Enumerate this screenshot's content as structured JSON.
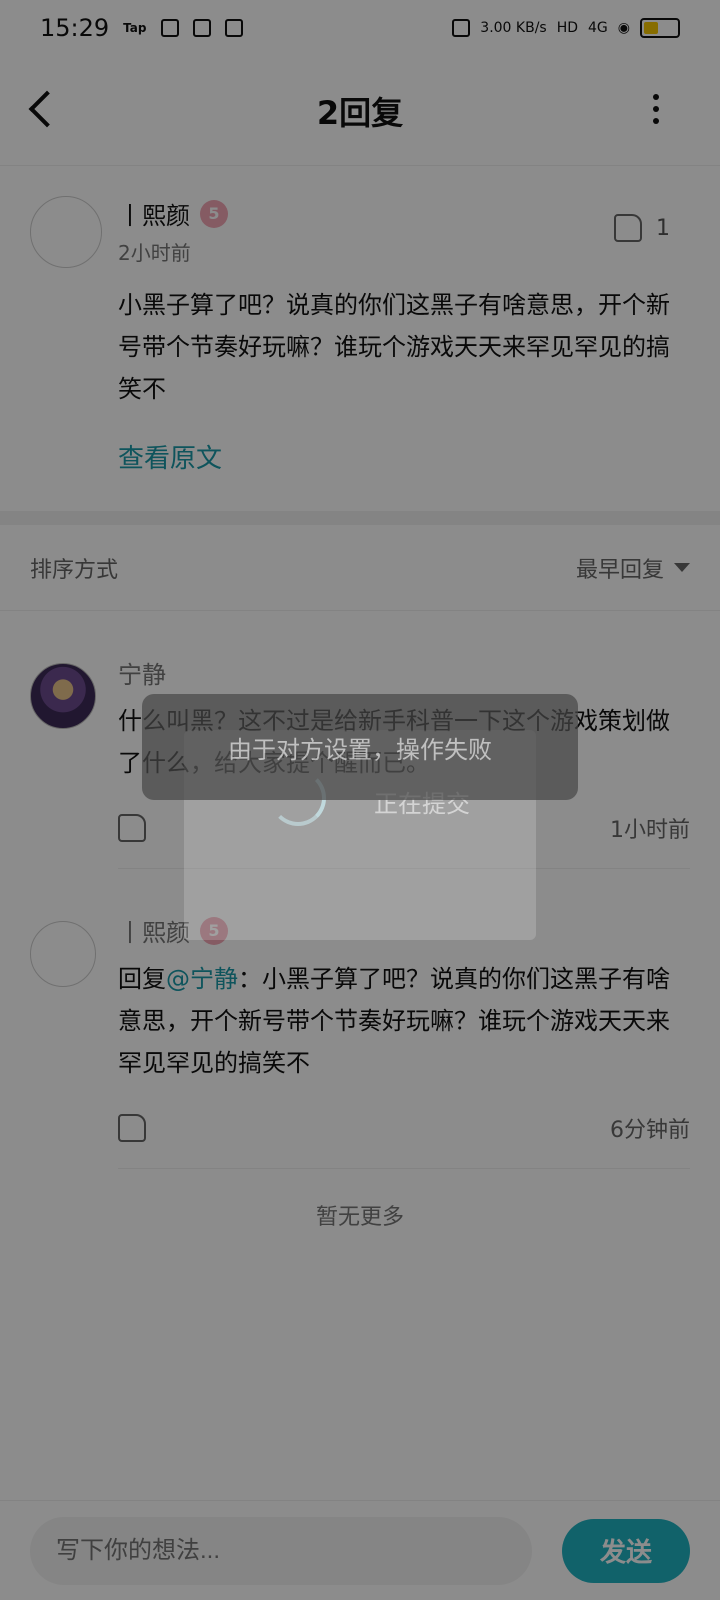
{
  "status_bar": {
    "time": "15:29",
    "tap_label": "Tap",
    "net_speed": "3.00 KB/s",
    "hd_label": "HD",
    "network": "4G",
    "icons": [
      "battery-saver-icon",
      "mail-icon",
      "wechat-icon",
      "vibrate-icon",
      "wifi-icon",
      "battery-icon"
    ],
    "battery_color": "#f6c700"
  },
  "header": {
    "title": "2回复"
  },
  "main_post": {
    "username": "丨熙颜",
    "badge": "5",
    "time": "2小时前",
    "likes": "1",
    "text": "小黑子算了吧？说真的你们这黑子有啥意思，开个新号带个节奏好玩嘛？谁玩个游戏天天来罕见罕见的搞笑不",
    "view_original": "查看原文"
  },
  "sort": {
    "label": "排序方式",
    "value": "最早回复"
  },
  "comments": [
    {
      "username": "宁静",
      "text": "什么叫黑？这不过是给新手科普一下这个游戏策划做了什么，给大家提个醒而已。",
      "time": "1小时前"
    },
    {
      "username": "丨熙颜",
      "badge": "5",
      "reply_prefix": "回复",
      "reply_at": "@宁静",
      "text": "：小黑子算了吧？说真的你们这黑子有啥意思，开个新号带个节奏好玩嘛？谁玩个游戏天天来罕见罕见的搞笑不",
      "time": "6分钟前"
    }
  ],
  "no_more": "暂无更多",
  "bottom_bar": {
    "placeholder": "写下你的想法...",
    "send": "发送"
  },
  "overlay": {
    "loading": "正在提交",
    "toast": "由于对方设置，操作失败"
  },
  "colors": {
    "accent": "#1fb2c2",
    "link": "#1a9aa8"
  }
}
